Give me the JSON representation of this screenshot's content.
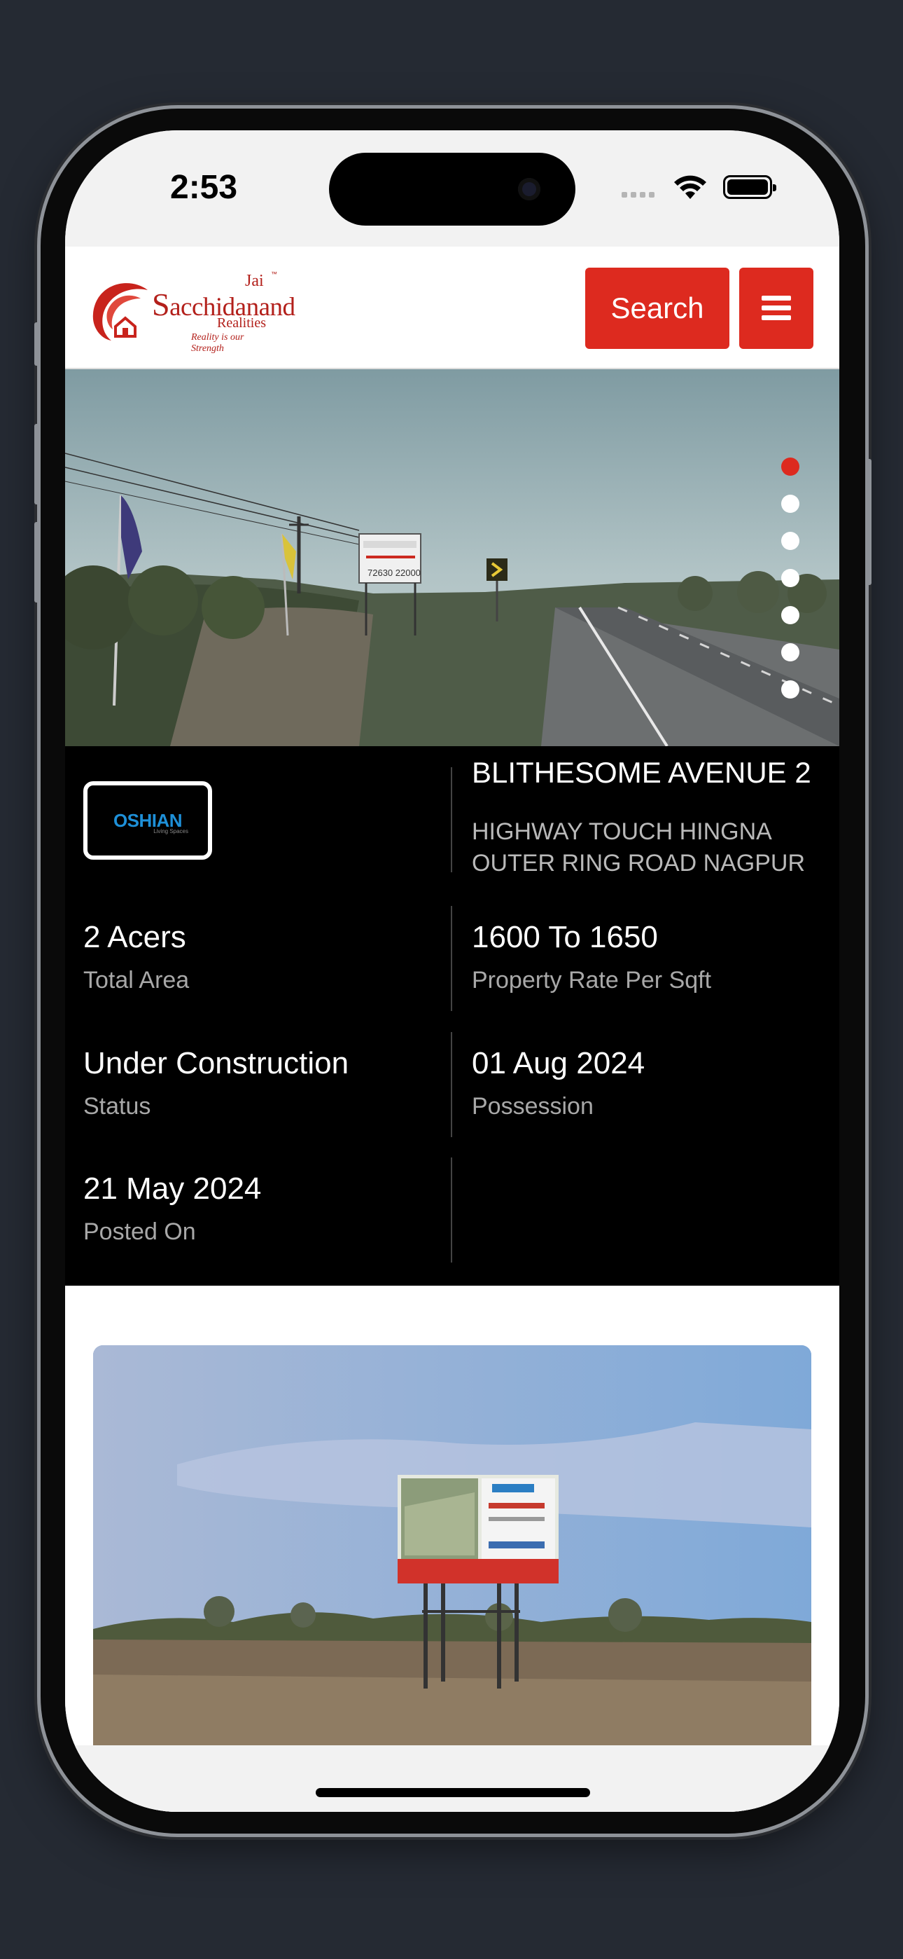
{
  "status_bar": {
    "time": "2:53"
  },
  "header": {
    "logo": {
      "jai": "Jai",
      "tm": "™",
      "name_initial": "S",
      "name_rest": "acchidanand",
      "sub": "Realities",
      "tagline": "Reality is our Strength"
    },
    "search_label": "Search"
  },
  "hero": {
    "slide_count": 7,
    "active_slide": 1,
    "billboard_phone": "72630 22000"
  },
  "property": {
    "builder_logo_text": "OSHIAN",
    "builder_logo_sub": "Living Spaces",
    "title": "BLITHESOME AVENUE 2",
    "address": "HIGHWAY TOUCH HINGNA OUTER RING ROAD NAGPUR",
    "details": [
      {
        "value": "2 Acers",
        "label": "Total Area"
      },
      {
        "value": "1600 To 1650",
        "label": "Property Rate Per Sqft"
      },
      {
        "value": "Under Construction",
        "label": "Status"
      },
      {
        "value": "01 Aug 2024",
        "label": "Possession"
      },
      {
        "value": "21 May 2024",
        "label": "Posted On"
      }
    ]
  },
  "colors": {
    "accent": "#dd2a1f",
    "info_bg": "#000000",
    "device_bg": "#252a33"
  }
}
